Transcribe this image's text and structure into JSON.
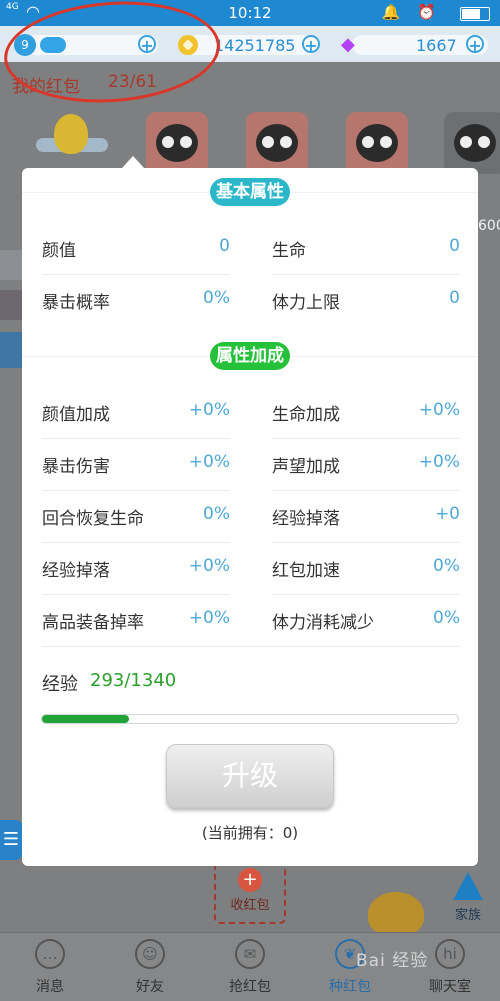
{
  "status_bar": {
    "network": "4G",
    "time": "10:12",
    "right_icons": "🔔 ⏰"
  },
  "resources": {
    "level": "9",
    "coins": "14251785",
    "gems": "1667",
    "plus_symbol": "+"
  },
  "background": {
    "red_packet_title": "我的红包",
    "red_packet_count": "23/61",
    "side_number": "600",
    "collect_label": "收红包",
    "family_label": "家族",
    "menu_glyph": "☰"
  },
  "modal": {
    "basic_section_title": "基本属性",
    "basic_attributes": [
      {
        "label": "颜值",
        "value": "0"
      },
      {
        "label": "生命",
        "value": "0"
      },
      {
        "label": "暴击概率",
        "value": "0%"
      },
      {
        "label": "体力上限",
        "value": "0"
      }
    ],
    "bonus_section_title": "属性加成",
    "bonus_attributes": [
      {
        "label": "颜值加成",
        "value": "+0%"
      },
      {
        "label": "生命加成",
        "value": "+0%"
      },
      {
        "label": "暴击伤害",
        "value": "+0%"
      },
      {
        "label": "声望加成",
        "value": "+0%"
      },
      {
        "label": "回合恢复生命",
        "value": "0%"
      },
      {
        "label": "经验掉落",
        "value": "+0"
      },
      {
        "label": "经验掉落",
        "value": "+0%"
      },
      {
        "label": "红包加速",
        "value": "0%"
      },
      {
        "label": "高品装备掉率",
        "value": "+0%"
      },
      {
        "label": "体力消耗减少",
        "value": "0%"
      }
    ],
    "experience_label": "经验",
    "experience_value": "293/1340",
    "experience_progress": 0.21,
    "upgrade_label": "升级",
    "owned_text": "(当前拥有：0)"
  },
  "bottom_nav": [
    {
      "label": "消息",
      "icon": "message-icon",
      "glyph": "…"
    },
    {
      "label": "好友",
      "icon": "friends-icon",
      "glyph": "☺"
    },
    {
      "label": "抢红包",
      "icon": "grab-redpacket-icon",
      "glyph": "✉"
    },
    {
      "label": "种红包",
      "icon": "plant-redpacket-icon",
      "glyph": "❦"
    },
    {
      "label": "聊天室",
      "icon": "chatroom-icon",
      "glyph": "hi"
    }
  ],
  "watermark": "Bai 经验",
  "colors": {
    "status_blue": "#1e88d0",
    "section_basic": "#2cb6c9",
    "section_bonus": "#25c13b",
    "value_blue": "#4fa9d6",
    "exp_green": "#22a33a",
    "annotation_red": "#d9372a"
  }
}
